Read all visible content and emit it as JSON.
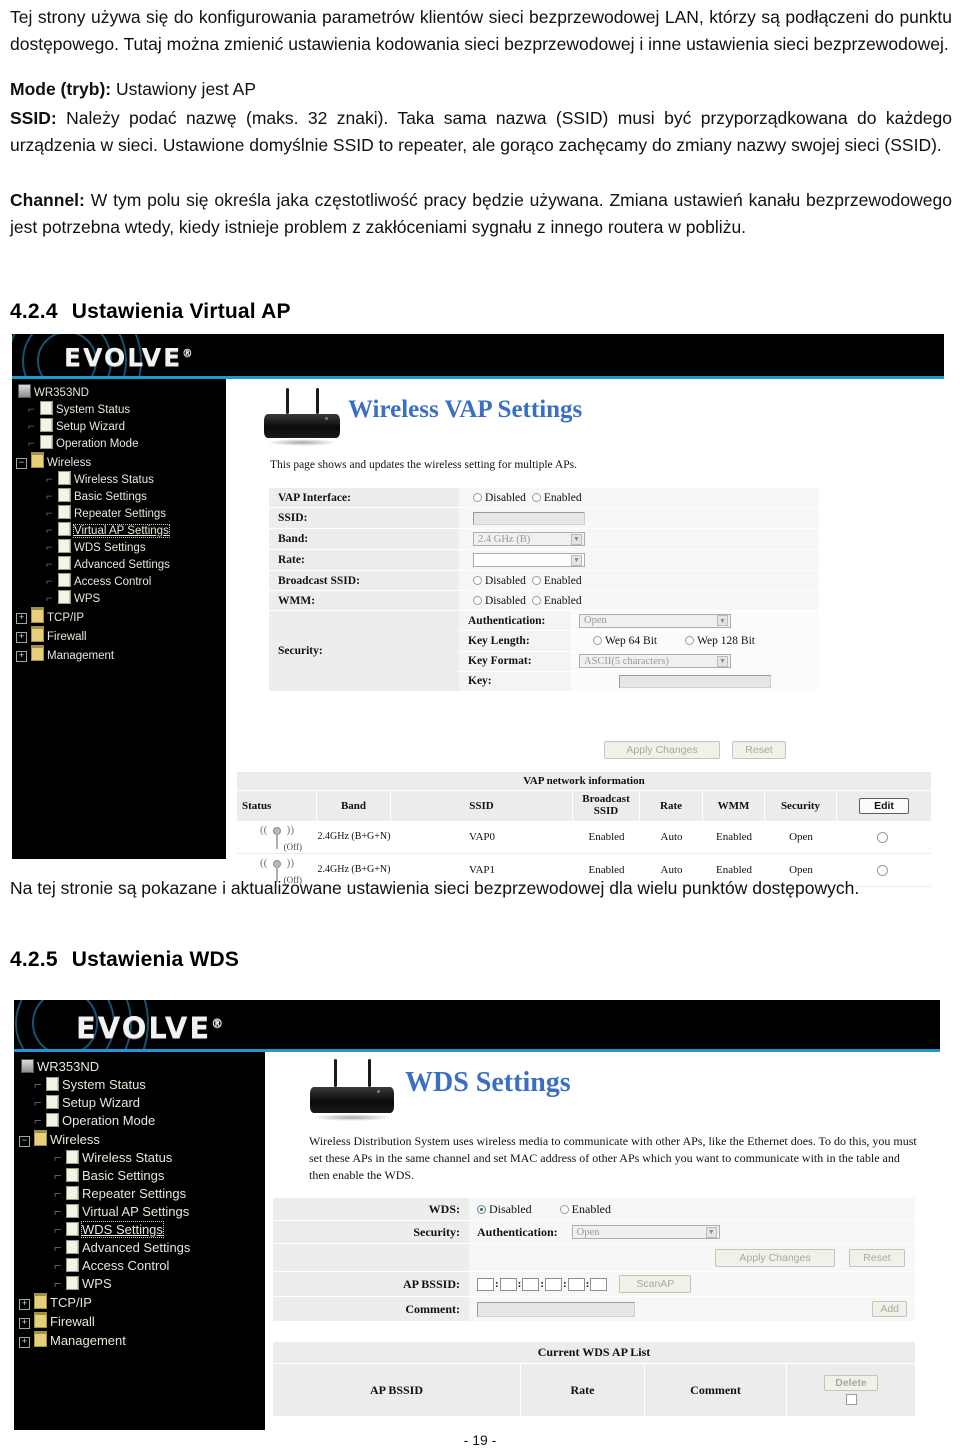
{
  "document": {
    "paragraphs": [
      {
        "id": "intro",
        "text": "Tej strony używa się do konfigurowania parametrów klientów sieci bezprzewodowej LAN, którzy są podłączeni do punktu dostępowego. Tutaj można zmienić ustawienia kodowania sieci bezprzewodowej i inne ustawienia sieci bezprzewodowej."
      },
      {
        "id": "mode",
        "label": "Mode (tryb):",
        "text": " Ustawiony jest AP"
      },
      {
        "id": "ssid",
        "label": "SSID:",
        "text": " Należy podać nazwę (maks. 32 znaki). Taka sama nazwa (SSID) musi być przyporządkowana do każdego urządzenia w sieci. Ustawione domyślnie SSID to repeater, ale gorąco zachęcamy do zmiany nazwy swojej sieci (SSID)."
      },
      {
        "id": "channel",
        "label": "Channel:",
        "text": " W tym polu się określa jaka częstotliwość pracy będzie używana. Zmiana ustawień kanału bezprzewodowego jest potrzebna wtedy, kiedy istnieje problem z zakłóceniami sygnału z innego routera w pobliżu."
      },
      {
        "id": "vap-caption",
        "text": "Na tej stronie są pokazane i aktualizowane ustawienia sieci bezprzewodowej dla wielu punktów dostępowych."
      }
    ],
    "headings": [
      {
        "id": "vap",
        "number": "4.2.4",
        "title": "Ustawienia Virtual AP"
      },
      {
        "id": "wds",
        "number": "4.2.5",
        "title": "Ustawienia WDS"
      }
    ],
    "page_number": "- 19 -"
  },
  "router_ui": {
    "brand": "EVOLVE",
    "brand_mark": "®",
    "device_model": "WR353ND",
    "sidebar_items": [
      {
        "label": "WR353ND",
        "type": "root",
        "depth": 0,
        "selected": false
      },
      {
        "label": "System Status",
        "type": "doc",
        "depth": 1,
        "selected": false
      },
      {
        "label": "Setup Wizard",
        "type": "doc",
        "depth": 1,
        "selected": false
      },
      {
        "label": "Operation Mode",
        "type": "doc",
        "depth": 1,
        "selected": false
      },
      {
        "label": "Wireless",
        "type": "folder-open",
        "depth": 1,
        "selected": false
      },
      {
        "label": "Wireless Status",
        "type": "doc",
        "depth": 2,
        "selected": false
      },
      {
        "label": "Basic Settings",
        "type": "doc",
        "depth": 2,
        "selected": false
      },
      {
        "label": "Repeater Settings",
        "type": "doc",
        "depth": 2,
        "selected": false
      },
      {
        "label": "Virtual AP Settings",
        "type": "doc",
        "depth": 2,
        "selected": false
      },
      {
        "label": "WDS Settings",
        "type": "doc",
        "depth": 2,
        "selected": false
      },
      {
        "label": "Advanced Settings",
        "type": "doc",
        "depth": 2,
        "selected": false
      },
      {
        "label": "Access Control",
        "type": "doc",
        "depth": 2,
        "selected": false
      },
      {
        "label": "WPS",
        "type": "doc",
        "depth": 2,
        "selected": false
      },
      {
        "label": "TCP/IP",
        "type": "folder",
        "depth": 1,
        "selected": false
      },
      {
        "label": "Firewall",
        "type": "folder",
        "depth": 1,
        "selected": false
      },
      {
        "label": "Management",
        "type": "folder",
        "depth": 1,
        "selected": false
      }
    ]
  },
  "vap_screen": {
    "selected_menu": "Virtual AP Settings",
    "title": "Wireless VAP Settings",
    "intro": "This page shows and updates the wireless setting for multiple APs.",
    "form": {
      "vap_interface": {
        "label": "VAP Interface:",
        "options": [
          "Disabled",
          "Enabled"
        ],
        "selected": ""
      },
      "ssid": {
        "label": "SSID:",
        "value": "",
        "placeholder": ""
      },
      "band": {
        "label": "Band:",
        "value": "2.4 GHz (B)"
      },
      "rate": {
        "label": "Rate:",
        "value": ""
      },
      "broadcast_ssid": {
        "label": "Broadcast SSID:",
        "options": [
          "Disabled",
          "Enabled"
        ],
        "selected": ""
      },
      "wmm": {
        "label": "WMM:",
        "options": [
          "Disabled",
          "Enabled"
        ],
        "selected": ""
      },
      "security": {
        "label": "Security:",
        "authentication": {
          "label": "Authentication:",
          "value": "Open"
        },
        "key_length": {
          "label": "Key Length:",
          "options": [
            "Wep 64 Bit",
            "Wep 128 Bit"
          ],
          "selected": ""
        },
        "key_format": {
          "label": "Key Format:",
          "value": "ASCII(5 characters)"
        },
        "key": {
          "label": "Key:",
          "value": ""
        }
      },
      "apply_label": "Apply Changes",
      "reset_label": "Reset"
    },
    "table": {
      "caption": "VAP network information",
      "columns": [
        "Status",
        "Band",
        "SSID",
        "Broadcast SSID",
        "Rate",
        "WMM",
        "Security"
      ],
      "action_label": "Edit",
      "rows": [
        {
          "status": "(Off)",
          "band": "2.4GHz (B+G+N)",
          "ssid": "VAP0",
          "broadcast_ssid": "Enabled",
          "rate": "Auto",
          "wmm": "Enabled",
          "security": "Open"
        },
        {
          "status": "(Off)",
          "band": "2.4GHz (B+G+N)",
          "ssid": "VAP1",
          "broadcast_ssid": "Enabled",
          "rate": "Auto",
          "wmm": "Enabled",
          "security": "Open"
        }
      ]
    }
  },
  "wds_screen": {
    "selected_menu": "WDS Settings",
    "title": "WDS Settings",
    "intro": "Wireless Distribution System uses wireless media to communicate with other APs, like the Ethernet does. To do this, you must set these APs in the same channel and set MAC address of other APs which you want to communicate with in the table and then enable the WDS.",
    "form": {
      "wds": {
        "label": "WDS:",
        "options": [
          "Disabled",
          "Enabled"
        ],
        "selected": "Disabled"
      },
      "security": {
        "label": "Security:",
        "authentication": {
          "label": "Authentication:",
          "value": "Open"
        }
      },
      "apply_label": "Apply Changes",
      "reset_label": "Reset",
      "ap_bssid": {
        "label": "AP BSSID:",
        "value": "",
        "separator": ":"
      },
      "scan_label": "ScanAP",
      "comment": {
        "label": "Comment:",
        "value": ""
      },
      "add_label": "Add"
    },
    "table": {
      "caption": "Current WDS AP List",
      "columns": [
        "AP BSSID",
        "Rate",
        "Comment"
      ],
      "action_label": "Delete",
      "rows": []
    }
  },
  "colors": {
    "brand_blue": "#1b9ad4",
    "title_blue": "#3a6fc4",
    "banner_black": "#000000",
    "label_grey": "#eceded"
  }
}
